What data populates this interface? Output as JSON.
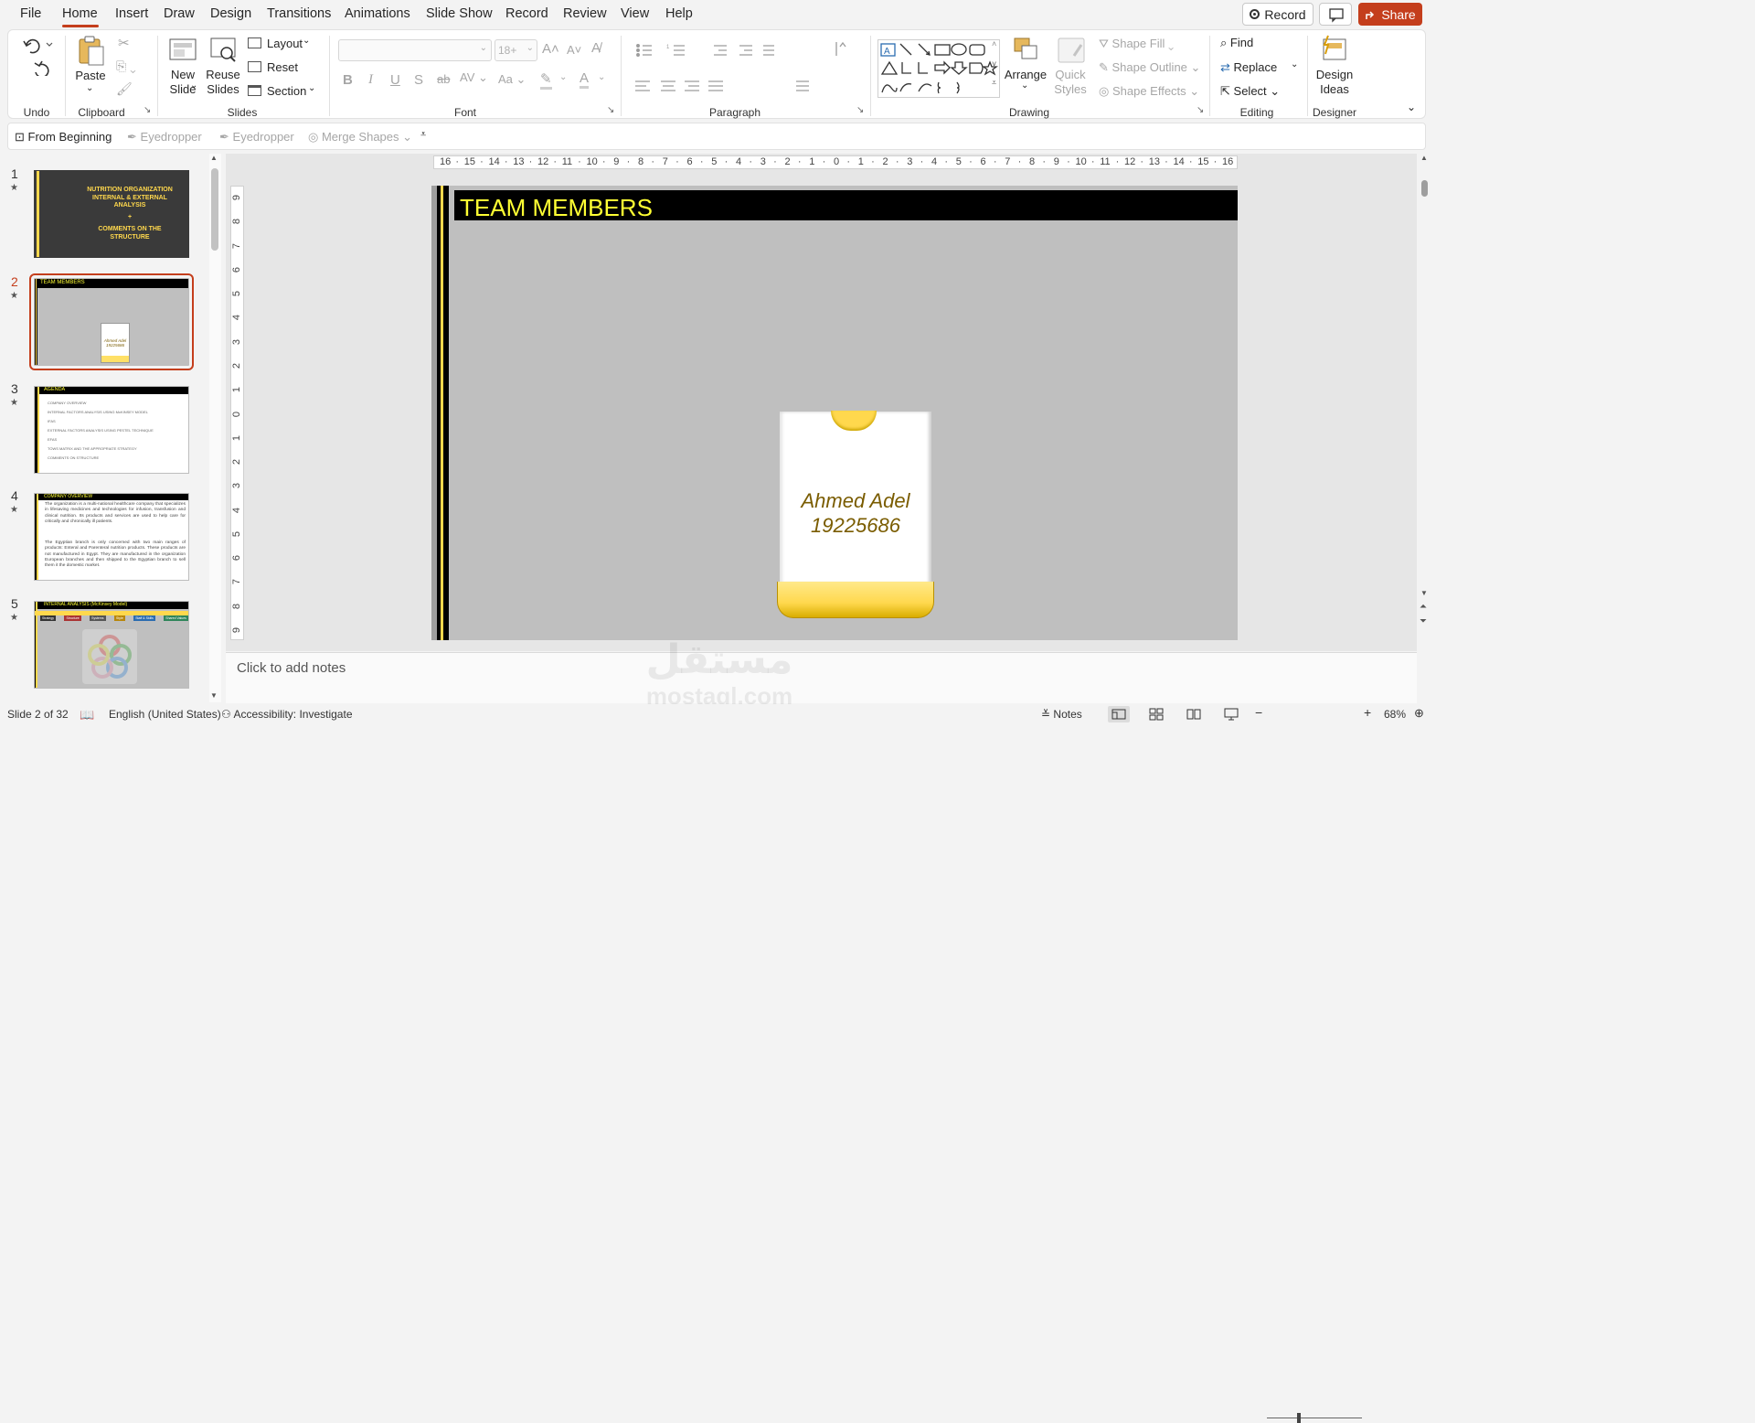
{
  "menubar": {
    "tabs": [
      "File",
      "Home",
      "Insert",
      "Draw",
      "Design",
      "Transitions",
      "Animations",
      "Slide Show",
      "Record",
      "Review",
      "View",
      "Help"
    ],
    "active_tab": "Home",
    "record_label": "Record",
    "share_label": "Share"
  },
  "ribbon": {
    "undo": {
      "group": "Undo"
    },
    "clipboard": {
      "group": "Clipboard",
      "paste": "Paste"
    },
    "slides": {
      "group": "Slides",
      "new_slide": "New\nSlide",
      "new_slide_1": "New",
      "new_slide_2": "Slide",
      "reuse_1": "Reuse",
      "reuse_2": "Slides",
      "layout": "Layout",
      "reset": "Reset",
      "section": "Section"
    },
    "font": {
      "group": "Font",
      "font_name": "",
      "font_size": "18+"
    },
    "paragraph": {
      "group": "Paragraph"
    },
    "drawing": {
      "group": "Drawing",
      "arrange": "Arrange",
      "quick_1": "Quick",
      "quick_2": "Styles",
      "shape_fill": "Shape Fill",
      "shape_outline": "Shape Outline",
      "shape_effects": "Shape Effects"
    },
    "editing": {
      "group": "Editing",
      "find": "Find",
      "replace": "Replace",
      "select": "Select"
    },
    "designer": {
      "group": "Designer",
      "design_1": "Design",
      "design_2": "Ideas"
    }
  },
  "qat": {
    "from_beginning": "From Beginning",
    "eyedropper1": "Eyedropper",
    "eyedropper2": "Eyedropper",
    "merge_shapes": "Merge Shapes"
  },
  "thumbnails": [
    {
      "num": "1",
      "lines": [
        "NUTRITION ORGANIZATION",
        "INTERNAL & EXTERNAL",
        "ANALYSIS",
        "+",
        "COMMENTS ON THE",
        "STRUCTURE"
      ]
    },
    {
      "num": "2",
      "title": "TEAM MEMBERS",
      "card_name": "Ahmed Adel",
      "card_id": "19225686"
    },
    {
      "num": "3",
      "title": "AGENDA",
      "items": [
        "COMPANY OVERVIEW",
        "INTERNAL FACTORS ANALYSIS USING McKINSEY MODEL",
        "IFAS",
        "EXTERNAL FACTORS ANALYSIS USING PESTEL TECHNIQUE",
        "EFAS",
        "TOWS MATRIX AND THE APPROPRIATE STRATEGY",
        "COMMENTS ON STRUCTURE"
      ]
    },
    {
      "num": "4",
      "title": "COMPANY OVERVIEW",
      "para1": "The organization is a multi-national healthcare company that specializes in lifesaving medicines and technologies for infusion, transfusion and clinical nutrition. Its products and services are used to help care for critically and chronically ill patients.",
      "para2": "The Egyptian branch is only concerned with two main ranges of products: Enteral and Parenteral nutrition products. These products are not manufactured in Egypt. They are manufactured in the organization European branches and then shipped to the Egyptian branch to sell them it the domestic market."
    },
    {
      "num": "5",
      "title": "INTERNAL ANALYSIS (McKinsey Model)",
      "tags": [
        "Strategy",
        "Structure",
        "Systems",
        "Style",
        "Staff & Skills",
        "Shared Values"
      ]
    }
  ],
  "slide": {
    "title": "TEAM MEMBERS",
    "card_name": "Ahmed Adel",
    "card_id": "19225686"
  },
  "ruler": {
    "h_labels": [
      "16",
      "15",
      "14",
      "13",
      "12",
      "11",
      "10",
      "9",
      "8",
      "7",
      "6",
      "5",
      "4",
      "3",
      "2",
      "1",
      "0",
      "1",
      "2",
      "3",
      "4",
      "5",
      "6",
      "7",
      "8",
      "9",
      "10",
      "11",
      "12",
      "13",
      "14",
      "15",
      "16"
    ],
    "v_labels": [
      "9",
      "8",
      "7",
      "6",
      "5",
      "4",
      "3",
      "2",
      "1",
      "0",
      "1",
      "2",
      "3",
      "4",
      "5",
      "6",
      "7",
      "8",
      "9"
    ]
  },
  "notes": {
    "placeholder": "Click to add notes"
  },
  "watermark": {
    "ar": "مستقل",
    "en": "mostaql.com"
  },
  "status": {
    "slide_of": "Slide 2 of 32",
    "language": "English (United States)",
    "accessibility": "Accessibility: Investigate",
    "notes": "Notes",
    "zoom": "68%"
  },
  "colors": {
    "accent": "#c43e1c",
    "slide_title": "#ffff33",
    "card_text": "#7a5c00",
    "card_yellow": "#ffe066"
  }
}
